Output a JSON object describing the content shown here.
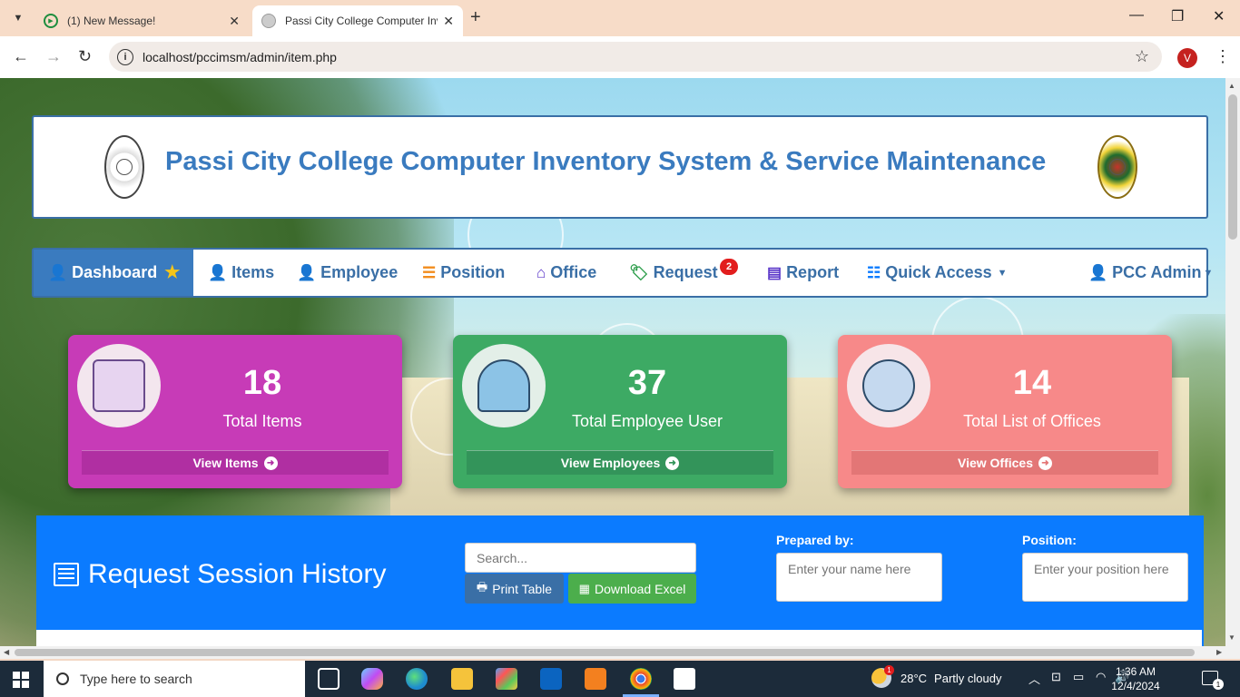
{
  "browser": {
    "tabs": [
      {
        "title": "(1) New Message!"
      },
      {
        "title": "Passi City College Computer Inv"
      }
    ],
    "new_tab_label": "+",
    "url": "localhost/pccimsm/admin/item.php",
    "profile_initial": "V"
  },
  "header": {
    "title": "Passi City College Computer Inventory System & Service Maintenance"
  },
  "nav": {
    "items": [
      {
        "label": "Dashboard",
        "icon": "user-icon"
      },
      {
        "label": "Items",
        "icon": "user-icon"
      },
      {
        "label": "Employee",
        "icon": "user-icon"
      },
      {
        "label": "Position",
        "icon": "server-icon"
      },
      {
        "label": "Office",
        "icon": "home-icon"
      },
      {
        "label": "Request",
        "icon": "tags-icon",
        "badge": "2"
      },
      {
        "label": "Report",
        "icon": "list-alt-icon"
      },
      {
        "label": "Quick Access",
        "icon": "th-list-icon"
      }
    ],
    "user_label": "PCC Admin"
  },
  "stats": [
    {
      "number": "18",
      "label": "Total Items",
      "link": "View Items",
      "color": "#c73bb7"
    },
    {
      "number": "37",
      "label": "Total Employee User",
      "link": "View Employees",
      "color": "#3daa64"
    },
    {
      "number": "14",
      "label": "Total List of Offices",
      "link": "View Offices",
      "color": "#f78989"
    }
  ],
  "request_panel": {
    "title": "Request Session History",
    "search_placeholder": "Search...",
    "print_label": "Print Table",
    "excel_label": "Download Excel",
    "prepared_label": "Prepared by:",
    "prepared_placeholder": "Enter your name here",
    "position_label": "Position:",
    "position_placeholder": "Enter your position here",
    "accent": "#0b7bff"
  },
  "taskbar": {
    "search_placeholder": "Type here to search",
    "weather_badge": "1",
    "temperature": "28°C",
    "weather": "Partly cloudy",
    "time": "1:36 AM",
    "date": "12/4/2024",
    "notification_count": "1"
  }
}
